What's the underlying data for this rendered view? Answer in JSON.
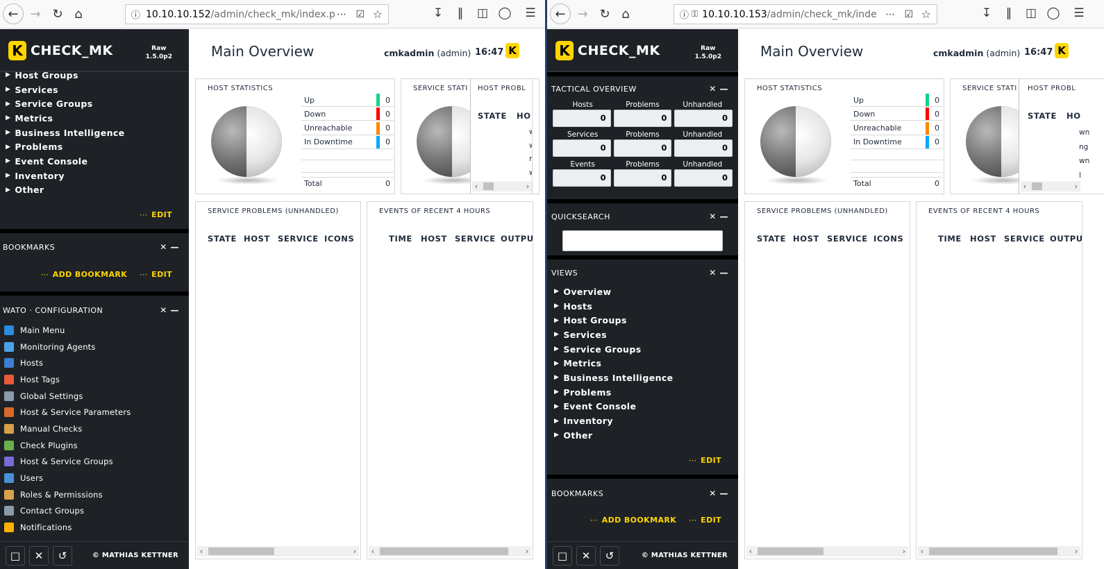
{
  "left": {
    "url_host": "10.10.10.152",
    "url_path": "/admin/check_mk/index.p",
    "sidebar": {
      "logo_text": "CHECK_MK",
      "version_line1": "Raw",
      "version_line2": "1.5.0p2",
      "tree_items": [
        "Host Groups",
        "Services",
        "Service Groups",
        "Metrics",
        "Business Intelligence",
        "Problems",
        "Event Console",
        "Inventory",
        "Other"
      ],
      "edit_label": "EDIT",
      "bookmarks_title": "BOOKMARKS",
      "add_bookmark_label": "ADD BOOKMARK",
      "bookmarks_edit_label": "EDIT",
      "wato_title": "WATO · CONFIGURATION",
      "wato_items": [
        "Main Menu",
        "Monitoring Agents",
        "Hosts",
        "Host Tags",
        "Global Settings",
        "Host & Service Parameters",
        "Manual Checks",
        "Check Plugins",
        "Host & Service Groups",
        "Users",
        "Roles & Permissions",
        "Contact Groups",
        "Notifications"
      ],
      "copyright": "© MATHIAS KETTNER"
    },
    "main": {
      "title": "Main Overview",
      "user": "cmkadmin",
      "role": "(admin)",
      "time": "16:47",
      "k": "K",
      "host_stats_title": "HOST STATISTICS",
      "service_stats_title": "SERVICE STATI",
      "host_problems_title": "HOST PROBL",
      "hp_col_state": "STATE",
      "hp_col_host": "HO",
      "hp_clip": [
        "wnti",
        "wn",
        "ng",
        "wn",
        "l"
      ],
      "service_problems_title": "SERVICE PROBLEMS (UNHANDLED)",
      "events_title": "EVENTS OF RECENT 4 HOURS",
      "sp_cols": [
        "STATE",
        "HOST",
        "SERVICE",
        "ICONS"
      ],
      "ev_cols": [
        "TIME",
        "HOST",
        "SERVICE",
        "OUTPUT"
      ]
    }
  },
  "host_stats": {
    "rows": [
      {
        "label": "Up",
        "value": "0",
        "color": "#13d389"
      },
      {
        "label": "Down",
        "value": "0",
        "color": "#ff0000"
      },
      {
        "label": "Unreachable",
        "value": "0",
        "color": "#ff8800"
      },
      {
        "label": "In Downtime",
        "value": "0",
        "color": "#00aaff"
      }
    ],
    "total_label": "Total",
    "total_value": "0"
  },
  "right": {
    "url_host": "10.10.10.153",
    "url_path": "/admin/check_mk/inde",
    "sidebar": {
      "logo_text": "CHECK_MK",
      "version_line1": "Raw",
      "version_line2": "1.5.0p2",
      "tactical_title": "TACTICAL OVERVIEW",
      "tac_rows": [
        {
          "labels": [
            "Hosts",
            "Problems",
            "Unhandled"
          ],
          "values": [
            "0",
            "0",
            "0"
          ]
        },
        {
          "labels": [
            "Services",
            "Problems",
            "Unhandled"
          ],
          "values": [
            "0",
            "0",
            "0"
          ]
        },
        {
          "labels": [
            "Events",
            "Problems",
            "Unhandled"
          ],
          "values": [
            "0",
            "0",
            "0"
          ]
        }
      ],
      "quicksearch_title": "QUICKSEARCH",
      "views_title": "VIEWS",
      "views_items": [
        "Overview",
        "Hosts",
        "Host Groups",
        "Services",
        "Service Groups",
        "Metrics",
        "Business Intelligence",
        "Problems",
        "Event Console",
        "Inventory",
        "Other"
      ],
      "edit_label": "EDIT",
      "bookmarks_title": "BOOKMARKS",
      "add_bookmark_label": "ADD BOOKMARK",
      "bookmarks_edit_label": "EDIT",
      "copyright": "© MATHIAS KETTNER"
    },
    "main": {
      "title": "Main Overview",
      "user": "cmkadmin",
      "role": "(admin)",
      "time": "16:47",
      "k": "K",
      "host_stats_title": "HOST STATISTICS",
      "service_stats_title": "SERVICE STATI",
      "host_problems_title": "HOST PROBL",
      "hp_col_state": "STATE",
      "hp_col_host": "HO",
      "hp_clip": [
        "wn",
        "ng",
        "wn",
        "l"
      ],
      "service_problems_title": "SERVICE PROBLEMS (UNHANDLED)",
      "events_title": "EVENTS OF RECENT 4 HOURS",
      "sp_cols": [
        "STATE",
        "HOST",
        "SERVICE",
        "ICONS"
      ],
      "ev_cols": [
        "TIME",
        "HOST",
        "SERVICE",
        "OUTPUT"
      ]
    }
  },
  "icons": {
    "back": "back-arrow-icon",
    "forward": "forward-arrow-icon",
    "reload": "reload-icon",
    "home": "home-icon",
    "info": "info-icon",
    "key": "key-icon",
    "more": "ellipsis-icon",
    "pocket": "pocket-icon",
    "star": "bookmark-star-icon",
    "download": "download-icon",
    "library": "library-icon",
    "sidebar": "sidebar-toggle-icon",
    "account": "account-icon",
    "menu": "hamburger-menu-icon"
  },
  "colors": {
    "accent": "#ffd500",
    "sidebar_bg": "#1e2226",
    "title": "#1f2a3a"
  }
}
